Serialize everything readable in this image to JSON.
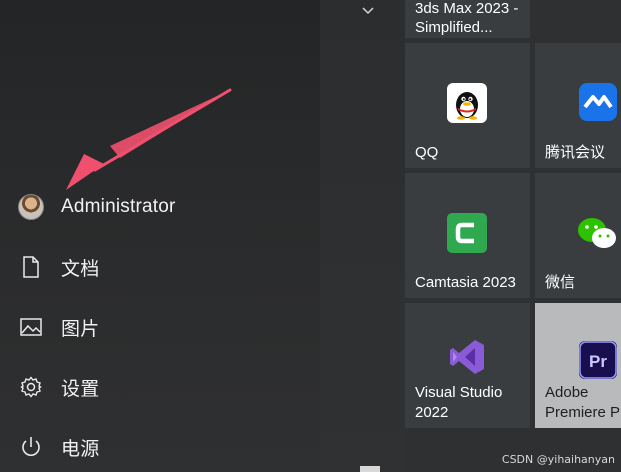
{
  "start_menu": {
    "user": {
      "name": "Administrator"
    },
    "nav": [
      {
        "id": "documents",
        "label": "文档",
        "icon": "document-icon"
      },
      {
        "id": "pictures",
        "label": "图片",
        "icon": "picture-icon"
      },
      {
        "id": "settings",
        "label": "设置",
        "icon": "gear-icon"
      },
      {
        "id": "power",
        "label": "电源",
        "icon": "power-icon"
      }
    ]
  },
  "tiles": {
    "top_partial": {
      "line1": "3ds Max 2023 -",
      "line2": "Simplified..."
    },
    "qq": {
      "label": "QQ"
    },
    "tencent_meeting": {
      "label": "腾讯会议"
    },
    "camtasia": {
      "label": "Camtasia 2023"
    },
    "wechat": {
      "label": "微信"
    },
    "visual_studio": {
      "line1": "Visual Studio",
      "line2": "2022"
    },
    "premiere": {
      "line1": "Adobe",
      "line2": "Premiere Pr"
    }
  },
  "watermark": "CSDN @yihaihanyan",
  "colors": {
    "arrow": "#f0506e",
    "accent_camtasia": "#2fa84f",
    "accent_premiere": "#1a0f4e"
  }
}
